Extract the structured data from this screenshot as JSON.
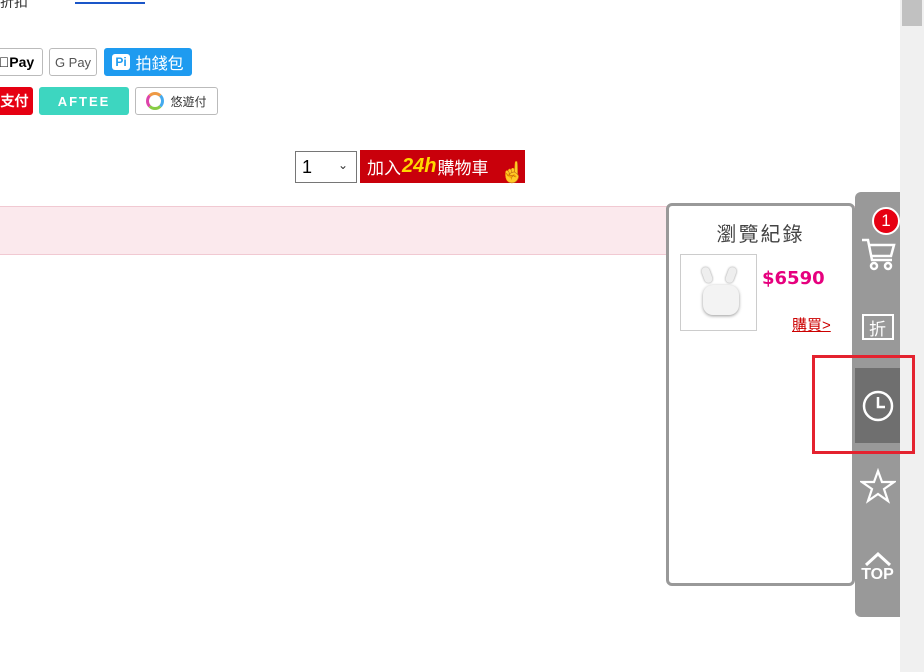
{
  "top": {
    "text": "折扣",
    "link_text": ""
  },
  "payments": {
    "apple_pay": "Pay",
    "google_pay": "G Pay",
    "pi_wallet_logo": "Pi",
    "pi_wallet": "拍錢包",
    "red_pay": "支付",
    "aftee": "AFTEE",
    "yosai": "悠遊付"
  },
  "purchase": {
    "quantity": "1",
    "add_to_cart_prefix": "加入",
    "add_to_cart_highlight": "24h",
    "add_to_cart_suffix": "購物車"
  },
  "history": {
    "title": "瀏覽紀錄",
    "items": [
      {
        "price": "$6590",
        "buy_label": "購買>"
      }
    ]
  },
  "sidebar": {
    "cart_count": "1",
    "discount_label": "折",
    "top_label": "TOP"
  },
  "colors": {
    "accent_red": "#c9000b",
    "price_pink": "#e6007e",
    "sidebar_gray": "#999999",
    "sidebar_active": "#6f6f6f",
    "highlight_red": "#e4222f"
  }
}
